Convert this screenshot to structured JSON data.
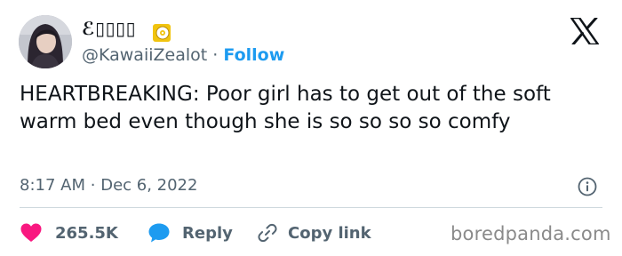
{
  "tweet": {
    "author": {
      "display_name": "ℰ▯▯▯▯",
      "handle": "@KawaiiZealot",
      "separator": "·",
      "follow_label": "Follow",
      "badge_icon": "cd-disc-emoji-icon",
      "avatar": "profile-photo"
    },
    "platform_icon": "x-logo-icon",
    "text": "HEARTBREAKING: Poor girl has to get out of the soft warm bed even though she is so so so so comfy",
    "time": "8:17 AM",
    "time_separator": "·",
    "date": "Dec 6, 2022",
    "info_icon": "info-icon",
    "actions": {
      "like_icon": "heart-icon",
      "like_count": "265.5K",
      "reply_icon": "speech-bubble-icon",
      "reply_label": "Reply",
      "copy_icon": "link-icon",
      "copy_label": "Copy link"
    }
  },
  "watermark": "boredpanda.com",
  "colors": {
    "text": "#0f1419",
    "secondary": "#536471",
    "accent": "#1d9bf0",
    "like": "#f91880",
    "divider": "#cfd9de",
    "watermark": "#8a8a8a"
  }
}
